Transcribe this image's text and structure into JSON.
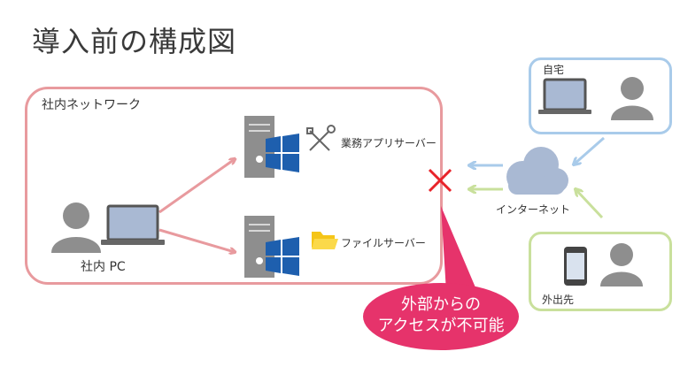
{
  "title": "導入前の構成図",
  "internal_network_label": "社内ネットワーク",
  "internal_pc_label": "社内 PC",
  "app_server_label": "業務アプリサーバー",
  "file_server_label": "ファイルサーバー",
  "home_label": "自宅",
  "internet_label": "インターネット",
  "mobile_label": "外出先",
  "callout": {
    "line1": "外部からの",
    "line2": "アクセスが不可能"
  },
  "colors": {
    "internal_border": "#e89a9e",
    "home_border": "#a9cbea",
    "mobile_border": "#c9e09c",
    "callout": "#e6336b",
    "blocked_mark": "#e8232a",
    "windows_logo": "#1e5fae",
    "folder": "#f5c518"
  },
  "icons": [
    "server-icon",
    "windows-logo-icon",
    "tools-icon",
    "folder-icon",
    "laptop-icon",
    "person-icon",
    "smartphone-icon",
    "cloud-icon",
    "blocked-x-icon"
  ]
}
